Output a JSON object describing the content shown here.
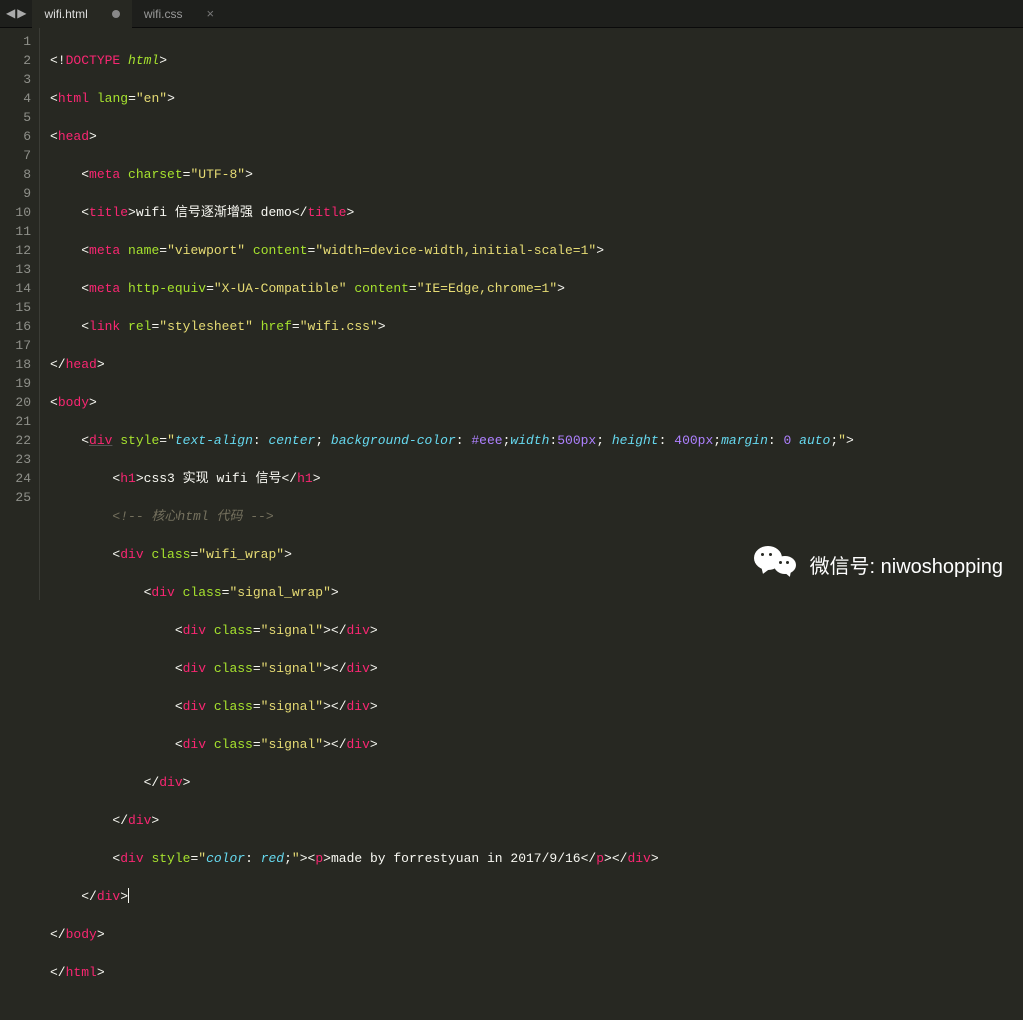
{
  "tabs": [
    {
      "name": "wifi.html",
      "active": true,
      "dirty": true
    },
    {
      "name": "wifi.css",
      "active": false,
      "dirty": false
    }
  ],
  "gutter": {
    "lines": [
      "1",
      "2",
      "3",
      "4",
      "5",
      "6",
      "7",
      "8",
      "9",
      "10",
      "11",
      "12",
      "13",
      "14",
      "15",
      "16",
      "17",
      "18",
      "19",
      "20",
      "21",
      "22",
      "23",
      "24",
      "25"
    ],
    "bookmarkLines": [
      11,
      23
    ]
  },
  "code": {
    "l1": {
      "t0": "<!",
      "t1": "DOCTYPE",
      "t2": " ",
      "t3": "html",
      "t4": ">"
    },
    "l2": {
      "t0": "<",
      "t1": "html",
      "t2": " ",
      "t3": "lang",
      "t4": "=",
      "t5": "\"en\"",
      "t6": ">"
    },
    "l3": {
      "t0": "<",
      "t1": "head",
      "t2": ">"
    },
    "l4": {
      "t0": "    <",
      "t1": "meta",
      "t2": " ",
      "t3": "charset",
      "t4": "=",
      "t5": "\"UTF-8\"",
      "t6": ">"
    },
    "l5": {
      "t0": "    <",
      "t1": "title",
      "t2": ">",
      "t3": "wifi 信号逐渐增强 demo",
      "t4": "</",
      "t5": "title",
      "t6": ">"
    },
    "l6": {
      "t0": "    <",
      "t1": "meta",
      "t2": " ",
      "t3": "name",
      "t4": "=",
      "t5": "\"viewport\"",
      "t6": " ",
      "t7": "content",
      "t8": "=",
      "t9": "\"width=device-width,initial-scale=1\"",
      "t10": ">"
    },
    "l7": {
      "t0": "    <",
      "t1": "meta",
      "t2": " ",
      "t3": "http-equiv",
      "t4": "=",
      "t5": "\"X-UA-Compatible\"",
      "t6": " ",
      "t7": "content",
      "t8": "=",
      "t9": "\"IE=Edge,chrome=1\"",
      "t10": ">"
    },
    "l8": {
      "t0": "    <",
      "t1": "link",
      "t2": " ",
      "t3": "rel",
      "t4": "=",
      "t5": "\"stylesheet\"",
      "t6": " ",
      "t7": "href",
      "t8": "=",
      "t9": "\"wifi.css\"",
      "t10": ">"
    },
    "l9": {
      "t0": "</",
      "t1": "head",
      "t2": ">"
    },
    "l10": {
      "t0": "<",
      "t1": "body",
      "t2": ">"
    },
    "l11": {
      "t0": "    <",
      "t1": "div",
      "t2": " ",
      "t3": "style",
      "t4": "=",
      "q": "\"",
      "p1": "text-align",
      "c1": ": ",
      "v1": "center",
      "s1": "; ",
      "p2": "background-color",
      "c2": ": ",
      "v2": "#eee",
      "s2": ";",
      "p3": "width",
      "c3": ":",
      "v3": "500px",
      "s3": "; ",
      "p4": "height",
      "c4": ": ",
      "v4": "400px",
      "s4": ";",
      "p5": "margin",
      "c5": ": ",
      "v5a": "0",
      "sp": " ",
      "v5b": "auto",
      "s5": ";",
      "q2": "\"",
      "t5": ">"
    },
    "l12": {
      "t0": "        <",
      "t1": "h1",
      "t2": ">",
      "t3": "css3 实现 wifi 信号",
      "t4": "</",
      "t5": "h1",
      "t6": ">"
    },
    "l13": {
      "t0": "        ",
      "t1": "<!-- 核心html 代码 -->"
    },
    "l14": {
      "t0": "        <",
      "t1": "div",
      "t2": " ",
      "t3": "class",
      "t4": "=",
      "t5": "\"wifi_wrap\"",
      "t6": ">"
    },
    "l15": {
      "t0": "            <",
      "t1": "div",
      "t2": " ",
      "t3": "class",
      "t4": "=",
      "t5": "\"signal_wrap\"",
      "t6": ">"
    },
    "l16": {
      "t0": "                <",
      "t1": "div",
      "t2": " ",
      "t3": "class",
      "t4": "=",
      "t5": "\"signal\"",
      "t6": "></",
      "t7": "div",
      "t8": ">"
    },
    "l17": {
      "t0": "                <",
      "t1": "div",
      "t2": " ",
      "t3": "class",
      "t4": "=",
      "t5": "\"signal\"",
      "t6": "></",
      "t7": "div",
      "t8": ">"
    },
    "l18": {
      "t0": "                <",
      "t1": "div",
      "t2": " ",
      "t3": "class",
      "t4": "=",
      "t5": "\"signal\"",
      "t6": "></",
      "t7": "div",
      "t8": ">"
    },
    "l19": {
      "t0": "                <",
      "t1": "div",
      "t2": " ",
      "t3": "class",
      "t4": "=",
      "t5": "\"signal\"",
      "t6": "></",
      "t7": "div",
      "t8": ">"
    },
    "l20": {
      "t0": "            </",
      "t1": "div",
      "t2": ">"
    },
    "l21": {
      "t0": "        </",
      "t1": "div",
      "t2": ">"
    },
    "l22": {
      "t0": "        <",
      "t1": "div",
      "t2": " ",
      "t3": "style",
      "t4": "=",
      "q": "\"",
      "p1": "color",
      "c1": ": ",
      "v1": "red",
      "s1": ";",
      "q2": "\"",
      "t5": "><",
      "t6": "p",
      "t7": ">",
      "t8": "made by forrestyuan in 2017/9/16",
      "t9": "</",
      "t10": "p",
      "t11": "></",
      "t12": "div",
      "t13": ">"
    },
    "l23": {
      "t0": "    </",
      "t1": "div",
      "t2": ">"
    },
    "l24": {
      "t0": "</",
      "t1": "body",
      "t2": ">"
    },
    "l25": {
      "t0": "</",
      "t1": "html",
      "t2": ">"
    }
  },
  "watermark": {
    "text": "微信号: niwoshopping"
  }
}
